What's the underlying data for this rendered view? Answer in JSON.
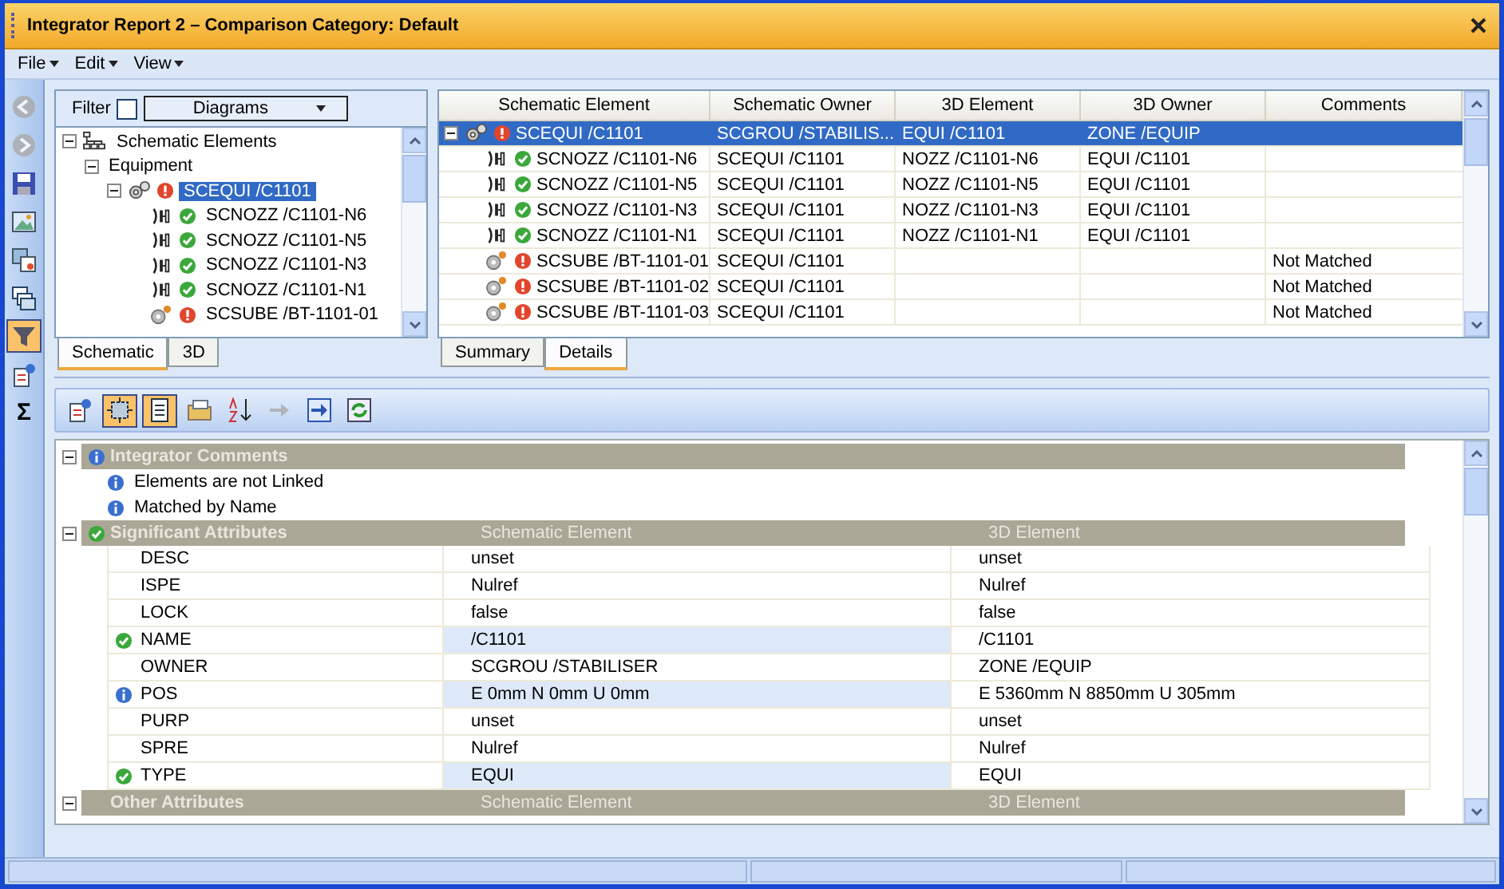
{
  "window": {
    "title": "Integrator Report 2 – Comparison Category: Default"
  },
  "menu": [
    "File",
    "Edit",
    "View"
  ],
  "side_tools": [
    {
      "kind": "back",
      "on": false,
      "disabled": true
    },
    {
      "kind": "forward",
      "on": false,
      "disabled": true
    },
    {
      "kind": "save",
      "on": false,
      "disabled": false
    },
    {
      "kind": "picture",
      "on": false,
      "disabled": false
    },
    {
      "kind": "compare",
      "on": false,
      "disabled": false
    },
    {
      "kind": "windows",
      "on": false,
      "disabled": false
    },
    {
      "kind": "filter",
      "on": true,
      "disabled": false
    },
    {
      "kind": "attribute",
      "on": false,
      "disabled": false
    },
    {
      "kind": "sigma",
      "glyph": "Σ",
      "on": false,
      "disabled": false
    }
  ],
  "tree_panel": {
    "filter_label": "Filter",
    "filter_checked": false,
    "dropdown": "Diagrams",
    "items": [
      {
        "label": "Schematic Elements",
        "kind": "root",
        "expanded": true,
        "selected": false,
        "children": [
          {
            "label": "Equipment",
            "expanded": true,
            "selected": false,
            "children": [
              {
                "label": "SCEQUI /C1101",
                "kind": "equipment",
                "matched": false,
                "expanded": true,
                "selected": true,
                "children": [
                  {
                    "label": "SCNOZZ /C1101-N6",
                    "kind": "nozzle",
                    "matched": true,
                    "selected": false
                  },
                  {
                    "label": "SCNOZZ /C1101-N5",
                    "kind": "nozzle",
                    "matched": true,
                    "selected": false
                  },
                  {
                    "label": "SCNOZZ /C1101-N3",
                    "kind": "nozzle",
                    "matched": true,
                    "selected": false
                  },
                  {
                    "label": "SCNOZZ /C1101-N1",
                    "kind": "nozzle",
                    "matched": true,
                    "selected": false
                  },
                  {
                    "label": "SCSUBE /BT-1101-01",
                    "kind": "subequipment",
                    "matched": false,
                    "selected": false
                  }
                ]
              }
            ]
          }
        ]
      }
    ],
    "tabs": [
      {
        "label": "Schematic",
        "selected": true
      },
      {
        "label": "3D",
        "selected": false
      }
    ]
  },
  "grid": {
    "columns": [
      "Schematic Element",
      "Schematic Owner",
      "3D Element",
      "3D Owner",
      "Comments"
    ],
    "rows": [
      {
        "kind": "equipment",
        "matched": false,
        "expanded": true,
        "selected": true,
        "schematic_element": "SCEQUI /C1101",
        "schematic_owner": "SCGROU  /STABILIS...",
        "model_element": "EQUI /C1101",
        "model_owner": "ZONE /EQUIP"
      },
      {
        "kind": "nozzle",
        "matched": true,
        "selected": false,
        "schematic_element": "SCNOZZ /C1101-N6",
        "schematic_owner": "SCEQUI /C1101",
        "model_element": "NOZZ /C1101-N6",
        "model_owner": "EQUI /C1101"
      },
      {
        "kind": "nozzle",
        "matched": true,
        "selected": false,
        "schematic_element": "SCNOZZ /C1101-N5",
        "schematic_owner": "SCEQUI /C1101",
        "model_element": "NOZZ /C1101-N5",
        "model_owner": "EQUI /C1101"
      },
      {
        "kind": "nozzle",
        "matched": true,
        "selected": false,
        "schematic_element": "SCNOZZ /C1101-N3",
        "schematic_owner": "SCEQUI /C1101",
        "model_element": "NOZZ /C1101-N3",
        "model_owner": "EQUI /C1101"
      },
      {
        "kind": "nozzle",
        "matched": true,
        "selected": false,
        "schematic_element": "SCNOZZ /C1101-N1",
        "schematic_owner": "SCEQUI /C1101",
        "model_element": "NOZZ /C1101-N1",
        "model_owner": "EQUI /C1101"
      },
      {
        "kind": "subequipment",
        "matched": false,
        "selected": false,
        "schematic_element": "SCSUBE /BT-1101-01",
        "schematic_owner": "SCEQUI /C1101",
        "comments": "Not Matched"
      },
      {
        "kind": "subequipment",
        "matched": false,
        "selected": false,
        "schematic_element": "SCSUBE /BT-1101-02",
        "schematic_owner": "SCEQUI /C1101",
        "comments": "Not Matched"
      },
      {
        "kind": "subequipment",
        "matched": false,
        "selected": false,
        "schematic_element": "SCSUBE /BT-1101-03",
        "schematic_owner": "SCEQUI /C1101",
        "comments": "Not Matched"
      }
    ],
    "tabs": [
      {
        "label": "Summary",
        "selected": false
      },
      {
        "label": "Details",
        "selected": true
      }
    ]
  },
  "detail_tools": [
    {
      "kind": "numbered",
      "on": false,
      "disabled": false
    },
    {
      "kind": "select",
      "on": true,
      "disabled": false
    },
    {
      "kind": "page",
      "on": true,
      "disabled": false
    },
    {
      "kind": "folder",
      "on": false,
      "disabled": false
    },
    {
      "kind": "sort",
      "on": false,
      "disabled": false
    },
    {
      "kind": "arrow",
      "on": false,
      "disabled": true
    },
    {
      "kind": "export",
      "on": false,
      "disabled": false
    },
    {
      "kind": "refresh",
      "on": false,
      "disabled": false
    }
  ],
  "sections": [
    {
      "kind": "comments",
      "title": "Integrator Comments",
      "expanded": true,
      "lines": [
        "Elements are not Linked",
        "Matched by Name"
      ]
    },
    {
      "kind": "attributes",
      "title": "Significant Attributes",
      "matched": true,
      "expanded": true,
      "column_headers": [
        "Schematic Element",
        "3D Element"
      ],
      "rows": [
        {
          "kind": "plain",
          "name": "DESC",
          "schematic": "unset",
          "model": "unset",
          "highlighted": false
        },
        {
          "kind": "plain",
          "name": "ISPE",
          "schematic": "Nulref",
          "model": "Nulref",
          "highlighted": false
        },
        {
          "kind": "plain",
          "name": "LOCK",
          "schematic": "false",
          "model": "false",
          "highlighted": false
        },
        {
          "kind": "matched",
          "name": "NAME",
          "schematic": "/C1101",
          "model": "/C1101",
          "highlighted": true
        },
        {
          "kind": "plain",
          "name": "OWNER",
          "schematic": "SCGROU /STABILISER",
          "model": "ZONE /EQUIP",
          "highlighted": false
        },
        {
          "kind": "info",
          "name": "POS",
          "schematic": "E 0mm N 0mm U 0mm",
          "model": "E 5360mm N 8850mm U 305mm",
          "highlighted": true
        },
        {
          "kind": "plain",
          "name": "PURP",
          "schematic": "unset",
          "model": "unset",
          "highlighted": false
        },
        {
          "kind": "plain",
          "name": "SPRE",
          "schematic": "Nulref",
          "model": "Nulref",
          "highlighted": false
        },
        {
          "kind": "matched",
          "name": "TYPE",
          "schematic": "EQUI",
          "model": "EQUI",
          "highlighted": true
        }
      ]
    },
    {
      "kind": "attributes",
      "title": "Other Attributes",
      "expanded": true,
      "column_headers": [
        "Schematic Element",
        "3D Element"
      ]
    }
  ]
}
